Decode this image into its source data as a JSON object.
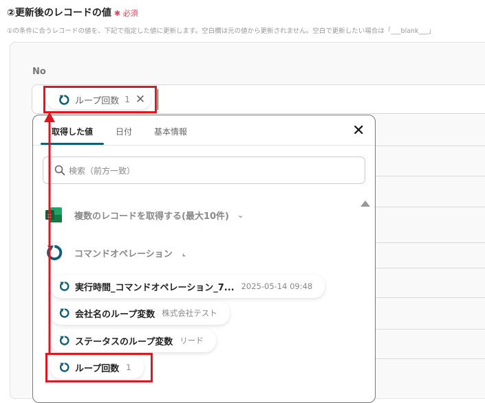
{
  "section": {
    "title": "②更新後のレコードの値",
    "required_mark": "✱ 必須",
    "description": "①の条件に合うレコードの値を、下記で指定した値に更新します。空白欄は元の値から更新されません。空白で更新したい場合は「___blank___」"
  },
  "field": {
    "label": "No",
    "chip": {
      "label": "ループ回数",
      "value": "1",
      "icon": "loop-icon"
    }
  },
  "popup": {
    "tabs": [
      {
        "label": "取得した値",
        "active": true
      },
      {
        "label": "日付"
      },
      {
        "label": "基本情報"
      }
    ],
    "search_placeholder": "検索（前方一致）",
    "groups": [
      {
        "label": "複数のレコードを取得する(最大10件)",
        "icon": "excel-icon",
        "expanded": false
      },
      {
        "label": "コマンドオペレーション",
        "icon": "loop-icon",
        "expanded": true
      }
    ],
    "items": [
      {
        "label": "実行時間_コマンドオペレーション_7...",
        "value": "2025-05-14 09:48"
      },
      {
        "label": "会社名のループ変数",
        "value": "株式会社テスト"
      },
      {
        "label": "ステータスのループ変数",
        "value": "リード"
      },
      {
        "label": "ループ回数",
        "value": "1",
        "highlighted": true
      }
    ]
  },
  "colors": {
    "accent": "#0e5f7a",
    "annotation": "#e0161e",
    "required": "#e8425a"
  }
}
